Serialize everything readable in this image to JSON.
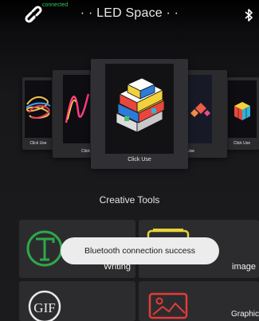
{
  "header": {
    "status": "connected",
    "title": "· · LED Space · ·",
    "bluetooth_icon": "bluetooth-icon",
    "link_icon": "link-icon"
  },
  "carousel": {
    "cards": [
      {
        "label": "Click Use",
        "art": "neon-scribble"
      },
      {
        "label": "Click",
        "art": "neon-wave"
      },
      {
        "label": "Click Use",
        "art": "colored-blocks"
      },
      {
        "label": "Use",
        "art": "diamonds"
      },
      {
        "label": "Click Use",
        "art": "cube"
      }
    ]
  },
  "section": {
    "title": "Creative Tools"
  },
  "tools": [
    {
      "label": "Writing",
      "icon": "writing-icon"
    },
    {
      "label": "image",
      "icon": "image-icon"
    },
    {
      "label": "GIF",
      "icon": "gif-icon"
    },
    {
      "label": "Graphic",
      "icon": "graphic-icon"
    }
  ],
  "toast": {
    "message": "Bluetooth connection success"
  },
  "colors": {
    "background": "#1b1b1d",
    "connected": "#32c85a",
    "accent_red": "#e53b35",
    "accent_green": "#2ea84a",
    "accent_yellow": "#e8d43a"
  }
}
